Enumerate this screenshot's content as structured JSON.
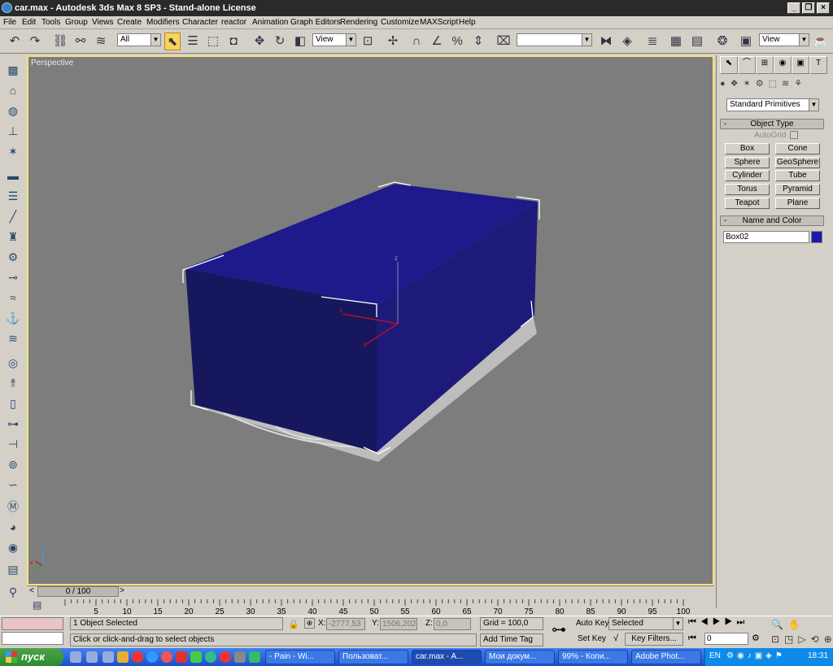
{
  "window": {
    "title": "car.max - Autodesk 3ds Max 8 SP3 - Stand-alone License"
  },
  "menu": [
    "File",
    "Edit",
    "Tools",
    "Group",
    "Views",
    "Create",
    "Modifiers",
    "Character",
    "reactor",
    "Animation",
    "Graph Editors",
    "Rendering",
    "Customize",
    "MAXScript",
    "Help"
  ],
  "toolbar": {
    "selection_filter": "All",
    "ref_coord": "View",
    "named_selection": "",
    "render_type": "View"
  },
  "viewport": {
    "label": "Perspective",
    "gizmo_x": "x",
    "gizmo_y": "y",
    "gizmo_z": "z"
  },
  "timeslider": {
    "frame": "0 / 100",
    "prev": "<",
    "next": ">"
  },
  "trackbar": {
    "ticks": [
      "5",
      "10",
      "15",
      "20",
      "25",
      "30",
      "35",
      "40",
      "45",
      "50",
      "55",
      "60",
      "65",
      "70",
      "75",
      "80",
      "85",
      "90",
      "95",
      "100"
    ]
  },
  "command_panel": {
    "dropdown": "Standard Primitives",
    "object_type_header": "Object Type",
    "autogrid": "AutoGrid",
    "buttons": [
      "Box",
      "Cone",
      "Sphere",
      "GeoSphere",
      "Cylinder",
      "Tube",
      "Torus",
      "Pyramid",
      "Teapot",
      "Plane"
    ],
    "name_color_header": "Name and Color",
    "object_name": "Box02",
    "object_color": "#1a1aaa",
    "collapse": "-"
  },
  "status": {
    "selection": "1 Object Selected",
    "prompt": "Click or click-and-drag to select objects",
    "x_label": "X:",
    "x_value": "-2777,53",
    "y_label": "Y:",
    "y_value": "1506,202",
    "z_label": "Z:",
    "z_value": "0,0",
    "grid": "Grid = 100,0",
    "add_time_tag": "Add Time Tag",
    "auto_key": "Auto Key",
    "set_key": "Set Key",
    "key_mode": "Selected",
    "key_filters": "Key Filters...",
    "frame_field": "0"
  },
  "taskbar": {
    "start": "пуск",
    "tasks": [
      "- Pain - Wi...",
      "Пользоват...",
      "car.max - A...",
      "Мои докум...",
      "99% - Копи...",
      "Adobe Phot..."
    ],
    "lang": "EN",
    "clock": "18:31"
  },
  "colors": {
    "box_front": "#17175e",
    "box_top": "#1e1a8c",
    "box_side": "#1e1a7a",
    "viewport_bg": "#7d7d7d",
    "active_border": "#f6e37a"
  }
}
